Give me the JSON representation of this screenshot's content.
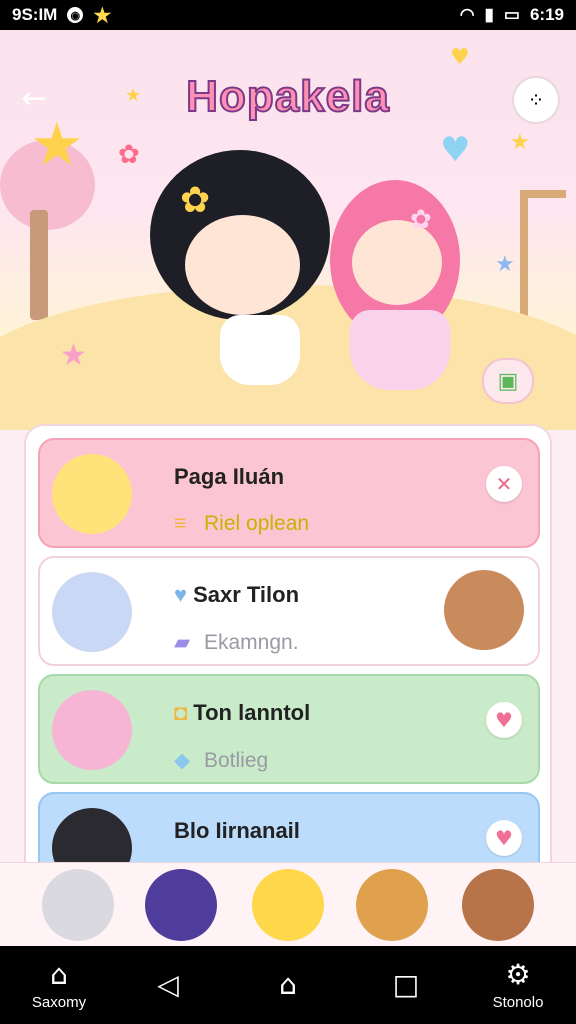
{
  "status_bar": {
    "time_left": "9S:IM",
    "time_right": "6:19"
  },
  "header": {
    "title": "Hopakela"
  },
  "cards": [
    {
      "title": "Paga Iluán",
      "subtitle": "Riel oplean",
      "subtitle_color": "#c8b400",
      "action_icon": "close-icon"
    },
    {
      "title": "Saxr Tilon",
      "subtitle": "Ekamngn.",
      "subtitle_color": "#9a9aa5",
      "action_icon": "none"
    },
    {
      "title": "Ton lanntol",
      "subtitle": "Botlieg",
      "subtitle_color": "#9a9aa5",
      "action_icon": "heart-icon"
    },
    {
      "title": "Blo Iirnanail",
      "subtitle": "",
      "subtitle_color": "#9a9aa5",
      "action_icon": "heart-icon"
    }
  ],
  "nav": {
    "home_label": "Saxomy",
    "settings_label": "Stonolo"
  },
  "colors": {
    "card_pink": "#fbc5d3",
    "card_white": "#ffffff",
    "card_green": "#c9ebc9",
    "card_blue": "#bcdcfb"
  }
}
